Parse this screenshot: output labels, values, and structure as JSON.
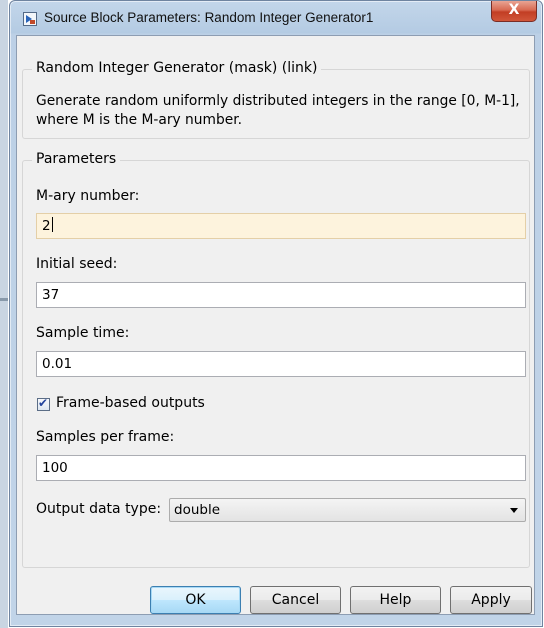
{
  "window": {
    "title": "Source Block Parameters: Random Integer Generator1",
    "close_glyph": "X"
  },
  "mask": {
    "legend": "Random Integer Generator (mask) (link)",
    "description_line1": "Generate random uniformly distributed integers in the range [0, M-1],",
    "description_line2": "where M is the M-ary number."
  },
  "parameters": {
    "legend": "Parameters",
    "mary_label": "M-ary number:",
    "mary_value": "2",
    "seed_label": "Initial seed:",
    "seed_value": "37",
    "sample_time_label": "Sample time:",
    "sample_time_value": "0.01",
    "frame_based_label": "Frame-based outputs",
    "frame_based_checked": true,
    "samples_per_frame_label": "Samples per frame:",
    "samples_per_frame_value": "100",
    "output_type_label": "Output data type:",
    "output_type_value": "double"
  },
  "buttons": {
    "ok": "OK",
    "cancel": "Cancel",
    "help": "Help",
    "apply": "Apply"
  }
}
